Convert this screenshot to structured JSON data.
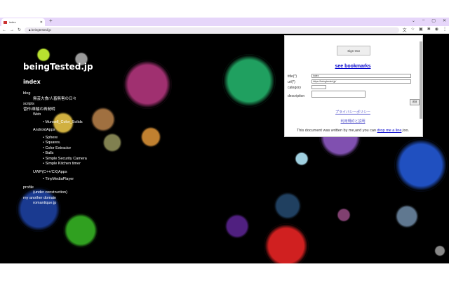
{
  "browser": {
    "tab_title": "index",
    "url": "beingtested.jp",
    "new_tab": "+",
    "controls": [
      "⌄",
      "–",
      "▢",
      "✕"
    ]
  },
  "site": {
    "title": "beingTested.jp",
    "heading": "index",
    "blog": "blog",
    "blog_sub": "無芸大食/人畜無害の日々",
    "scripts": "scripts",
    "reinvent": "習作/車輪の再発明",
    "web": "Web",
    "web_items": [
      "Munsell_Color_Solids"
    ],
    "android": "AndroidApps",
    "android_items": [
      "Sphere",
      "Squares.",
      "Color Extractor",
      "Balls",
      "Simple Security Camera",
      "Simple Kitchen timer"
    ],
    "uwp": "UWP(C++/CX)Apps",
    "uwp_items": [
      "TinyMediaPlayer"
    ],
    "profile": "profile",
    "profile_sub": "(under construction)",
    "another": "my another domain",
    "another_sub": "romantique.jp"
  },
  "popup": {
    "sign_out": "Sign Out",
    "see_bookmarks": "see bookmarks",
    "title_label": "title(*)",
    "title_value": "index",
    "url_label": "url(*)",
    "url_value": "https://beingtested.jp/",
    "category_label": "category",
    "category_value": "",
    "description_label": "description",
    "description_value": "",
    "send": "送信",
    "privacy": "プライバシーポリシー",
    "terms": "利用規約と説明",
    "footer_pre": "This document was written by me,and you can ",
    "footer_link": "drop me a line",
    "footer_post": ",too."
  }
}
